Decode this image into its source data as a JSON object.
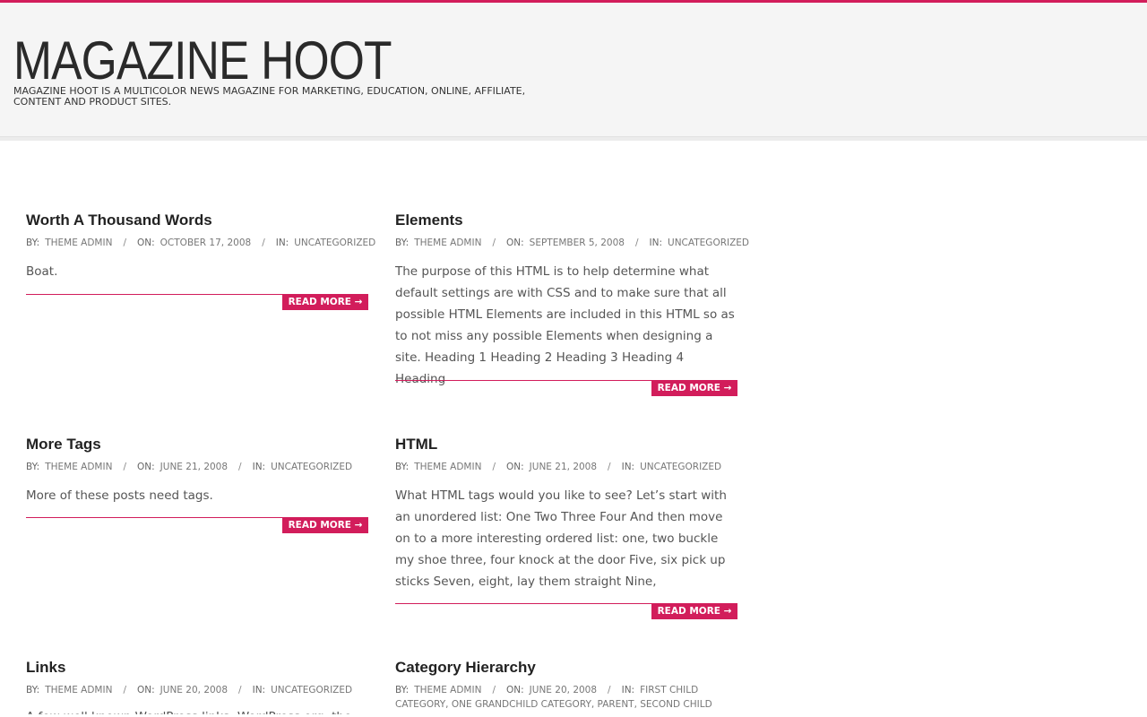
{
  "site": {
    "title": "MAGAZINE HOOT",
    "tagline": "MAGAZINE HOOT IS A MULTICOLOR NEWS MAGAZINE FOR MARKETING, EDUCATION, ONLINE, AFFILIATE, CONTENT AND PRODUCT SITES."
  },
  "colors": {
    "accent": "#d21d5b",
    "header_bg": "#f5f5f5"
  },
  "labels": {
    "by": "BY:",
    "on": "ON:",
    "in": "IN:",
    "sep": "/",
    "read_more": "READ MORE →"
  },
  "posts": [
    {
      "title": "Worth A Thousand Words",
      "author": "THEME ADMIN",
      "date": "OCTOBER 17, 2008",
      "category": "UNCATEGORIZED",
      "excerpt": "Boat."
    },
    {
      "title": "Elements",
      "author": "THEME ADMIN",
      "date": "SEPTEMBER 5, 2008",
      "category": "UNCATEGORIZED",
      "excerpt": "The purpose of this HTML is to help determine what default settings are with CSS and to make sure that all possible HTML Elements are included in this HTML so as to not miss any possible Elements when designing a site. Heading 1 Heading 2 Heading 3 Heading 4 Heading"
    },
    {
      "title": "More Tags",
      "author": "THEME ADMIN",
      "date": "JUNE 21, 2008",
      "category": "UNCATEGORIZED",
      "excerpt": "More of these posts need tags."
    },
    {
      "title": "HTML",
      "author": "THEME ADMIN",
      "date": "JUNE 21, 2008",
      "category": "UNCATEGORIZED",
      "excerpt": "What HTML tags would you like to see? Let’s start with an unordered list: One Two Three Four And then move on to a more interesting ordered list: one, two buckle my shoe three, four knock at the door Five, six pick up sticks Seven, eight, lay them straight Nine,"
    },
    {
      "title": "Links",
      "author": "THEME ADMIN",
      "date": "JUNE 20, 2008",
      "category": "UNCATEGORIZED",
      "excerpt": "A few well known WordPress links: WordPress.org, the"
    },
    {
      "title": "Category Hierarchy",
      "author": "THEME ADMIN",
      "date": "JUNE 20, 2008",
      "category": "FIRST CHILD CATEGORY, ONE GRANDCHILD CATEGORY, PARENT, SECOND CHILD CATEGORY",
      "excerpt": ""
    }
  ]
}
